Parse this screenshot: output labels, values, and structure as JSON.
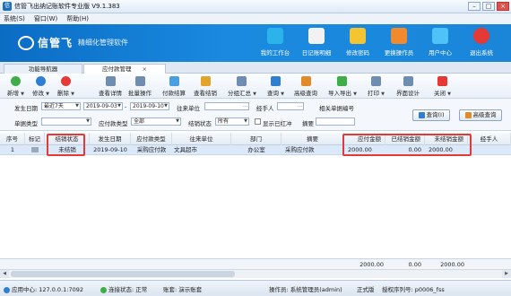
{
  "window": {
    "title": "信管飞出纳记账软件专业版 V9.1.383",
    "min_icon": "minimize-icon",
    "max_icon": "maximize-icon",
    "close_icon": "close-icon"
  },
  "menu": [
    "系统(S)",
    "窗口(W)",
    "帮助(H)"
  ],
  "brand": {
    "name": "信管飞",
    "slogan": "精细化管理软件"
  },
  "topnav": [
    {
      "label": "我的工作台",
      "icon": "monitor-icon",
      "color": "#2bb3ea"
    },
    {
      "label": "日记账明细",
      "icon": "ledger-icon",
      "color": "#f2f2f2"
    },
    {
      "label": "修改密码",
      "icon": "lock-icon",
      "color": "#f5c531"
    },
    {
      "label": "更换操作员",
      "icon": "user-switch-icon",
      "color": "#f08a2c"
    },
    {
      "label": "用户中心",
      "icon": "user-center-icon",
      "color": "#4fc3f7"
    },
    {
      "label": "退出系统",
      "icon": "power-icon",
      "color": "#e53935"
    }
  ],
  "tabs": [
    {
      "label": "功能导航器",
      "active": false
    },
    {
      "label": "应付款管理",
      "active": true,
      "close": "×"
    }
  ],
  "toolbar": [
    {
      "label": "新增",
      "icon": "add-icon",
      "color": "#3fae49",
      "caret": true
    },
    {
      "label": "修改",
      "icon": "edit-icon",
      "color": "#2f7fd0",
      "caret": true
    },
    {
      "label": "删除",
      "icon": "delete-icon",
      "color": "#e53935",
      "caret": true
    },
    {
      "label": "查看详情",
      "icon": "details-icon",
      "color": "#6f8db0"
    },
    {
      "label": "批量操作",
      "icon": "batch-icon",
      "color": "#6f8db0"
    },
    {
      "label": "付款结算",
      "icon": "payment-icon",
      "color": "#4a9fe0"
    },
    {
      "label": "查看结销",
      "icon": "settle-view-icon",
      "color": "#e0a52a"
    },
    {
      "label": "分组汇总",
      "icon": "group-icon",
      "color": "#6f8db0",
      "caret": true
    },
    {
      "label": "查询",
      "icon": "search-icon",
      "color": "#2f7fd0",
      "caret": true
    },
    {
      "label": "高级查询",
      "icon": "advanced-search-icon",
      "color": "#e08a2a"
    },
    {
      "label": "导入导出",
      "icon": "import-export-icon",
      "color": "#3fae49",
      "caret": true
    },
    {
      "label": "打印",
      "icon": "print-icon",
      "color": "#6f8db0",
      "caret": true
    },
    {
      "label": "界面设计",
      "icon": "design-icon",
      "color": "#6f8db0"
    },
    {
      "label": "关闭",
      "icon": "close-window-icon",
      "color": "#e53935",
      "caret": true
    }
  ],
  "filter": {
    "date_label": "发生日期",
    "date_range": "最近7天",
    "date_from": "2019-09-03",
    "date_to": "2019-09-10",
    "date_sep": "-",
    "dealer_label": "往来单位",
    "dealer_value": "",
    "handler_label": "经手人",
    "handler_value": "",
    "related_no_label": "相关单据编号",
    "related_no_value": "",
    "doc_type_label": "单据类型",
    "doc_type_value": "",
    "pay_type_label": "应付款类型",
    "pay_type_value": "全部",
    "settle_status_label": "结销状态",
    "settle_status_value": "所有",
    "show_red_label": "显示已红冲",
    "summary_label": "摘要",
    "summary_value": "",
    "query_button": "查询(I)",
    "advanced_button": "高级查询"
  },
  "grid": {
    "columns": [
      "序号",
      "标记",
      "结销状态",
      "发生日期",
      "应付款类型",
      "往来单位",
      "部门",
      "摘要",
      "应付金额",
      "已结销金额",
      "未结销金额",
      "经手人"
    ],
    "rows": [
      {
        "seq": "1",
        "mark": "",
        "status": "未结销",
        "date": "2019-09-10",
        "type": "采购应付款",
        "dealer": "文具超市",
        "dept": "办公室",
        "summary": "采购应付款",
        "amount": "2000.00",
        "settled": "0.00",
        "unsettled": "2000.00",
        "handler": ""
      }
    ],
    "totals": {
      "amount": "2000.00",
      "settled": "0.00",
      "unsettled": "2000.00"
    }
  },
  "status": {
    "server": "应用中心: 127.0.0.1:7092",
    "connection": "连接状态: 正常",
    "account": "账套: 演示账套",
    "operator": "操作员: 系统管理员(admin)",
    "edition": "正式版",
    "license": "授权序列号: p0006_fss"
  },
  "colors": {
    "banner": "#1a8ae0",
    "highlight": "#e53935",
    "selected_row": "#dbe9fb",
    "status_ok": "#3fae49"
  }
}
